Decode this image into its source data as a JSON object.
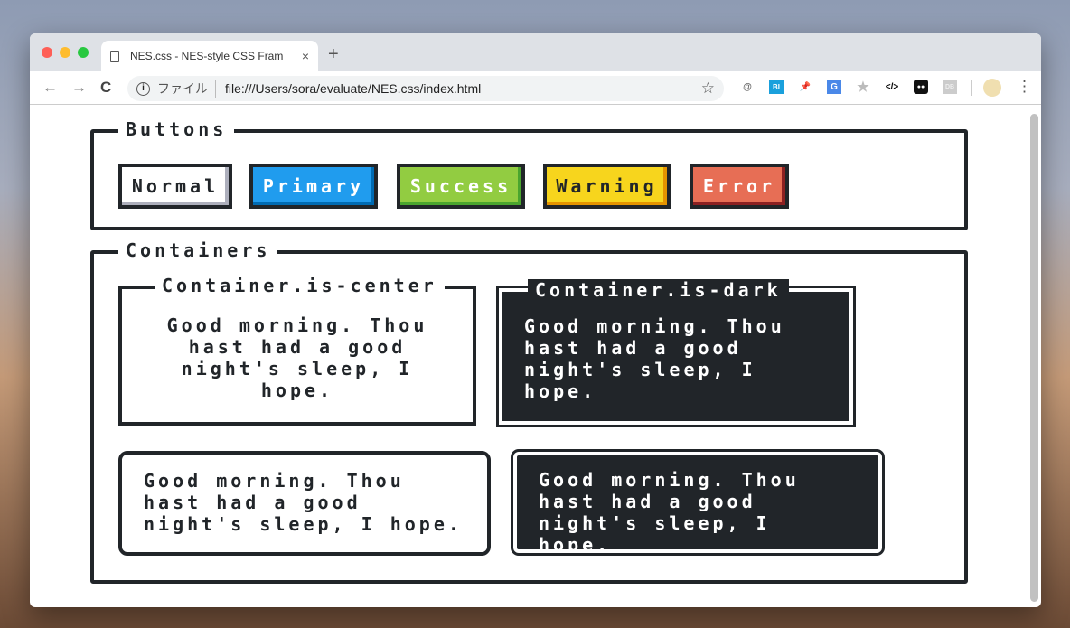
{
  "browser": {
    "tab_title": "NES.css - NES-style CSS Fram",
    "new_tab": "+",
    "close": "×",
    "url_label": "ファイル",
    "url": "file:///Users/sora/evaluate/NES.css/index.html",
    "info": "i",
    "back": "←",
    "forward": "→",
    "reload": "C",
    "bookmark": "☆",
    "menu": "⋮",
    "extensions": [
      "@",
      "BI",
      "📌",
      "G",
      "★",
      "</>",
      "●●",
      "DB"
    ]
  },
  "colors": {
    "primary": "#209cee",
    "success": "#92cc41",
    "warning": "#f7d51d",
    "error": "#e76e55",
    "dark": "#212529"
  },
  "buttons_section": {
    "title": "Buttons",
    "buttons": [
      "Normal",
      "Primary",
      "Success",
      "Warning",
      "Error"
    ]
  },
  "containers_section": {
    "title": "Containers",
    "center_title": "Container.is-center",
    "dark_title": "Container.is-dark",
    "center_text": "Good morning. Thou hast had a good night's sleep, I hope.",
    "dark_text": "Good morning. Thou hast had a good night's sleep, I hope.",
    "rounded_text": "Good morning. Thou hast had a good night's sleep, I hope.",
    "rounded_dark_text": "Good morning. Thou hast had a good night's sleep, I hope."
  }
}
